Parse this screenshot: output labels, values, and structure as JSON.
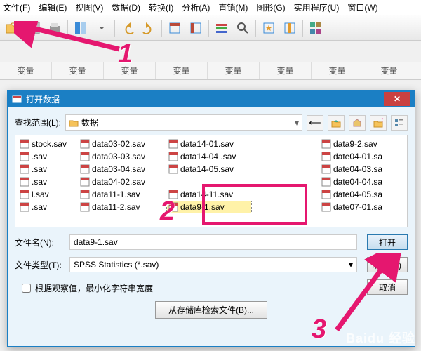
{
  "menu": [
    "文件(F)",
    "编辑(E)",
    "视图(V)",
    "数据(D)",
    "转换(I)",
    "分析(A)",
    "直销(M)",
    "图形(G)",
    "实用程序(U)",
    "窗口(W)"
  ],
  "col_header": "变量",
  "dialog": {
    "title": "打开数据",
    "look_label": "查找范围(L):",
    "look_value": "数据",
    "filename_label": "文件名(N):",
    "filename_value": "data9-1.sav",
    "filetype_label": "文件类型(T):",
    "filetype_value": "SPSS Statistics (*.sav)",
    "checkbox_label": "根据观察值，最小化字符串宽度",
    "open_btn": "打开",
    "paste_btn": "粘贴(P)",
    "cancel_btn": "取消",
    "retrieve_btn": "从存储库检索文件(B)..."
  },
  "files": {
    "col1": [
      "stock.sav",
      ".sav",
      ".sav",
      ".sav",
      "l.sav",
      ".sav"
    ],
    "col2": [
      "data03-02.sav",
      "data03-03.sav",
      "data03-04.sav",
      "data04-02.sav",
      "data11-1.sav",
      "data11-2.sav"
    ],
    "col3": [
      "data14-01.sav",
      "data14-04 .sav",
      "data14-05.sav",
      "",
      "data14-11.sav",
      "data9-1.sav"
    ],
    "col4": [
      "data9-2.sav",
      "date04-01.sa",
      "date04-03.sa",
      "date04-04.sa",
      "date04-05.sa",
      "date07-01.sa"
    ]
  },
  "annotations": {
    "n1": "1",
    "n2": "2",
    "n3": "3"
  },
  "watermark": "Baidu 经验"
}
